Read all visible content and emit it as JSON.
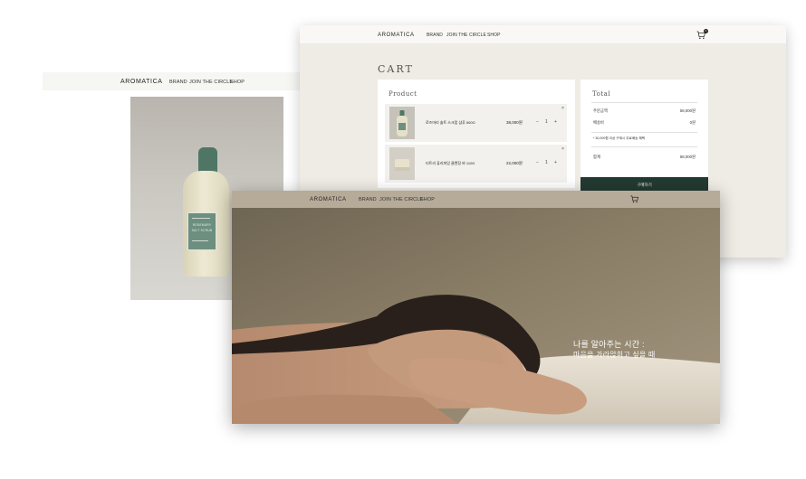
{
  "product_page": {
    "nav": {
      "logo": "AROMATICA",
      "links": [
        "BRAND",
        "JOIN THE CIRCLE",
        "SHOP"
      ]
    },
    "bottle": {
      "label_lines": [
        "ROSEMARY",
        "SALT SCRUB"
      ]
    }
  },
  "cart_page": {
    "nav": {
      "logo": "AROMATICA",
      "links": [
        "BRAND",
        "JOIN THE CIRCLE",
        "SHOP"
      ],
      "cart_count": "0"
    },
    "title": "CART",
    "product_heading": "Product",
    "items": [
      {
        "name": "로즈마리 솔트 스크럽 샴푸 500G",
        "price": "38,000원",
        "qty": "1"
      },
      {
        "name": "티트리 퓨리파잉 클렌징 바 110G",
        "price": "22,000원",
        "qty": "1"
      }
    ],
    "qty_minus": "−",
    "qty_plus": "+",
    "remove": "×",
    "total": {
      "heading": "Total",
      "order_label": "주문금액",
      "order_value": "58,000원",
      "shipping_label": "배송비",
      "shipping_value": "0원",
      "note": "* 30,000원 이상 구매시 무료배송 혜택",
      "sum_label": "합계",
      "sum_value": "58,000원"
    },
    "buy_button": "구매하기"
  },
  "main_page": {
    "nav": {
      "logo": "AROMATICA",
      "links": [
        "BRAND",
        "JOIN THE CIRCLE",
        "SHOP"
      ]
    },
    "hero": {
      "line1": "나를 알아주는 시간 :",
      "line2": "마음을 가라앉히고 싶을 때"
    }
  },
  "colors": {
    "accent_dark_green": "#233a32",
    "bottle_green": "#4f7665",
    "hero_brown": "#8c7e69",
    "cart_bg": "#efebe5"
  }
}
